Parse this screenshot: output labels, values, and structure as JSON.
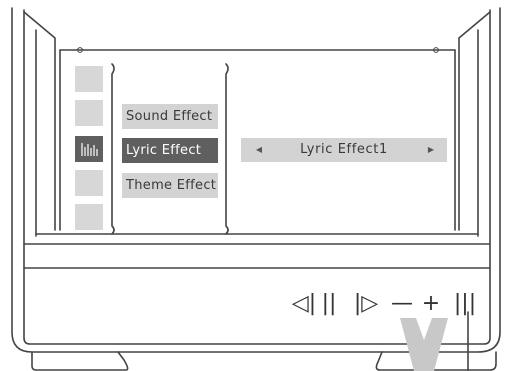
{
  "menu": {
    "items": [
      {
        "label": "Sound Effect",
        "selected": false
      },
      {
        "label": "Lyric Effect",
        "selected": true
      },
      {
        "label": "Theme Effect",
        "selected": false
      }
    ]
  },
  "selector": {
    "value": "Lyric Effect1",
    "left_arrow": "◀",
    "right_arrow": "▶"
  },
  "side_icons": [
    "blank",
    "blank",
    "equalizer-icon",
    "blank",
    "blank"
  ],
  "controls": {
    "prev": "◁|",
    "pause": "||",
    "next": "|▷",
    "minus": "—",
    "plus": "+",
    "bars": "|||"
  },
  "colors": {
    "selected_bg": "#5f5f5f",
    "item_bg": "#d3d3d3",
    "outline": "#444444",
    "accent_gray": "#c8c8c8"
  }
}
